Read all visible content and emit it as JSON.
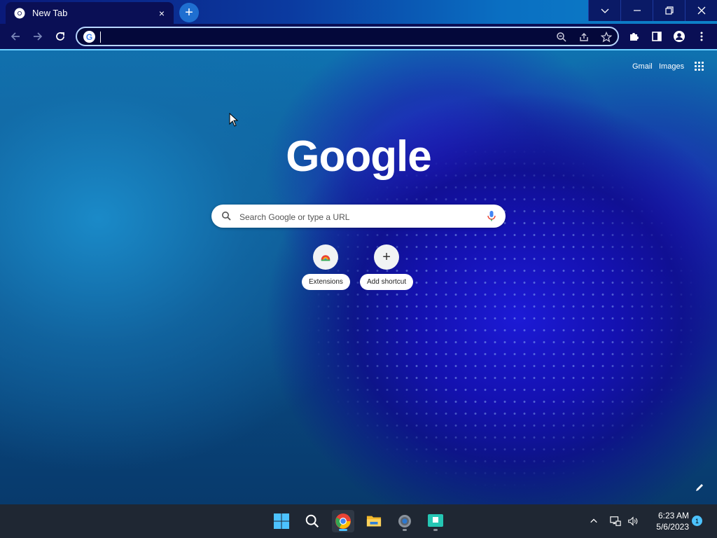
{
  "browser": {
    "tab": {
      "title": "New Tab",
      "close_glyph": "×"
    },
    "new_tab_glyph": "+",
    "window_controls": [
      "chevron-down-icon",
      "minimize-icon",
      "restore-icon",
      "close-icon"
    ],
    "omnibox": {
      "value": "",
      "search_engine_icon": "google-g-icon"
    }
  },
  "newtab": {
    "links": {
      "gmail": "Gmail",
      "images": "Images"
    },
    "logo": "Google",
    "search": {
      "placeholder": "Search Google or type a URL"
    },
    "shortcuts": [
      {
        "label": "Extensions",
        "icon": "chrome-web-store-icon"
      },
      {
        "label": "Add shortcut",
        "icon": "plus-icon",
        "glyph": "+"
      }
    ]
  },
  "taskbar": {
    "clock": {
      "time": "6:23 AM",
      "date": "5/6/2023"
    },
    "notification_count": "1",
    "apps": [
      "windows-start-icon",
      "search-icon",
      "chrome-icon",
      "file-explorer-icon",
      "settings-icon",
      "screenshot-app-icon"
    ]
  },
  "colors": {
    "tab_active": "#0a0f55",
    "omnibox_border": "#b8d6ff",
    "taskbar": "#1f2733",
    "accent": "#4cc2ff"
  }
}
